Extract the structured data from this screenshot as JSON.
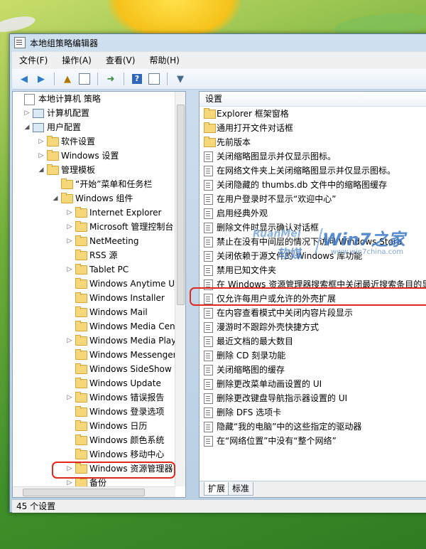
{
  "window": {
    "title": "本地组策略编辑器"
  },
  "menubar": [
    {
      "label": "文件(F)"
    },
    {
      "label": "操作(A)"
    },
    {
      "label": "查看(V)"
    },
    {
      "label": "帮助(H)"
    }
  ],
  "toolbar": {
    "back": "back-arrow-icon",
    "forward": "forward-arrow-icon",
    "up": "up-folder-icon",
    "show_hide": "show-hide-tree-icon",
    "export": "export-list-icon",
    "help": "help-icon",
    "properties": "properties-icon",
    "filter": "filter-icon"
  },
  "tree": [
    {
      "label": "本地计算机 策略",
      "level": 0,
      "icon": "policy"
    },
    {
      "label": "计算机配置",
      "level": 1,
      "icon": "pc",
      "expander": "▷"
    },
    {
      "label": "用户配置",
      "level": 1,
      "icon": "pc",
      "expander": "◢"
    },
    {
      "label": "软件设置",
      "level": 2,
      "icon": "folder",
      "expander": "▷"
    },
    {
      "label": "Windows 设置",
      "level": 2,
      "icon": "folder",
      "expander": "▷"
    },
    {
      "label": "管理模板",
      "level": 2,
      "icon": "folder",
      "expander": "◢"
    },
    {
      "label": "“开始”菜单和任务栏",
      "level": 3,
      "icon": "folder",
      "expander": ""
    },
    {
      "label": "Windows 组件",
      "level": 3,
      "icon": "folder",
      "expander": "◢"
    },
    {
      "label": "Internet Explorer",
      "level": 4,
      "icon": "folder",
      "expander": "▷"
    },
    {
      "label": "Microsoft 管理控制台",
      "level": 4,
      "icon": "folder",
      "expander": "▷"
    },
    {
      "label": "NetMeeting",
      "level": 4,
      "icon": "folder",
      "expander": "▷"
    },
    {
      "label": "RSS 源",
      "level": 4,
      "icon": "folder",
      "expander": ""
    },
    {
      "label": "Tablet PC",
      "level": 4,
      "icon": "folder",
      "expander": "▷"
    },
    {
      "label": "Windows Anytime Up",
      "level": 4,
      "icon": "folder",
      "expander": ""
    },
    {
      "label": "Windows Installer",
      "level": 4,
      "icon": "folder",
      "expander": ""
    },
    {
      "label": "Windows Mail",
      "level": 4,
      "icon": "folder",
      "expander": ""
    },
    {
      "label": "Windows Media Cen",
      "level": 4,
      "icon": "folder",
      "expander": ""
    },
    {
      "label": "Windows Media Play",
      "level": 4,
      "icon": "folder",
      "expander": "▷"
    },
    {
      "label": "Windows Messenger",
      "level": 4,
      "icon": "folder",
      "expander": ""
    },
    {
      "label": "Windows SideShow",
      "level": 4,
      "icon": "folder",
      "expander": ""
    },
    {
      "label": "Windows Update",
      "level": 4,
      "icon": "folder",
      "expander": ""
    },
    {
      "label": "Windows 错误报告",
      "level": 4,
      "icon": "folder",
      "expander": "▷"
    },
    {
      "label": "Windows 登录选项",
      "level": 4,
      "icon": "folder",
      "expander": ""
    },
    {
      "label": "Windows 日历",
      "level": 4,
      "icon": "folder",
      "expander": ""
    },
    {
      "label": "Windows 颜色系统",
      "level": 4,
      "icon": "folder",
      "expander": ""
    },
    {
      "label": "Windows 移动中心",
      "level": 4,
      "icon": "folder",
      "expander": ""
    },
    {
      "label": "Windows 资源管理器",
      "level": 4,
      "icon": "folder",
      "expander": "▷",
      "highlight": true
    },
    {
      "label": "备份",
      "level": 4,
      "icon": "folder",
      "expander": "▷"
    }
  ],
  "right_pane": {
    "header": "设置",
    "items": [
      {
        "label": "Explorer 框架窗格",
        "type": "folder"
      },
      {
        "label": "通用打开文件对话框",
        "type": "folder"
      },
      {
        "label": "先前版本",
        "type": "folder"
      },
      {
        "label": "关闭缩略图显示并仅显示图标。",
        "type": "setting"
      },
      {
        "label": "在网络文件夹上关闭缩略图显示并仅显示图标。",
        "type": "setting"
      },
      {
        "label": "关闭隐藏的 thumbs.db 文件中的缩略图缓存",
        "type": "setting"
      },
      {
        "label": "在用户登录时不显示“欢迎中心”",
        "type": "setting"
      },
      {
        "label": "启用经典外观",
        "type": "setting"
      },
      {
        "label": "删除文件时显示确认对话框",
        "type": "setting"
      },
      {
        "label": "禁止在没有中间层的情况下访问 Windows Stora",
        "type": "setting"
      },
      {
        "label": "关闭依赖于源文件的 Windows 库功能",
        "type": "setting"
      },
      {
        "label": "禁用已知文件夹",
        "type": "setting"
      },
      {
        "label": "在 Windows 资源管理器搜索框中关闭最近搜索条目的显示",
        "type": "setting",
        "highlight": true
      },
      {
        "label": "仅允许每用户或允许的外壳扩展",
        "type": "setting"
      },
      {
        "label": "在内容查看模式中关闭内容片段显示",
        "type": "setting"
      },
      {
        "label": "漫游时不跟踪外壳快捷方式",
        "type": "setting"
      },
      {
        "label": "最近文档的最大数目",
        "type": "setting"
      },
      {
        "label": "删除 CD 刻录功能",
        "type": "setting"
      },
      {
        "label": "关闭缩略图的缓存",
        "type": "setting"
      },
      {
        "label": "删除更改菜单动画设置的 UI",
        "type": "setting"
      },
      {
        "label": "删除更改键盘导航指示器设置的 UI",
        "type": "setting"
      },
      {
        "label": "删除 DFS 选项卡",
        "type": "setting"
      },
      {
        "label": "隐藏“我的电脑”中的这些指定的驱动器",
        "type": "setting"
      },
      {
        "label": "在“网络位置”中没有“整个网络”",
        "type": "setting"
      }
    ],
    "tabs": [
      {
        "label": "扩展"
      },
      {
        "label": "标准"
      }
    ]
  },
  "statusbar": {
    "text": "45 个设置"
  },
  "watermark": {
    "ruanmei": "RuanMei",
    "ruanmei_cn": "软媒",
    "win7": "Win7之家",
    "url": "www.win7china.com"
  }
}
